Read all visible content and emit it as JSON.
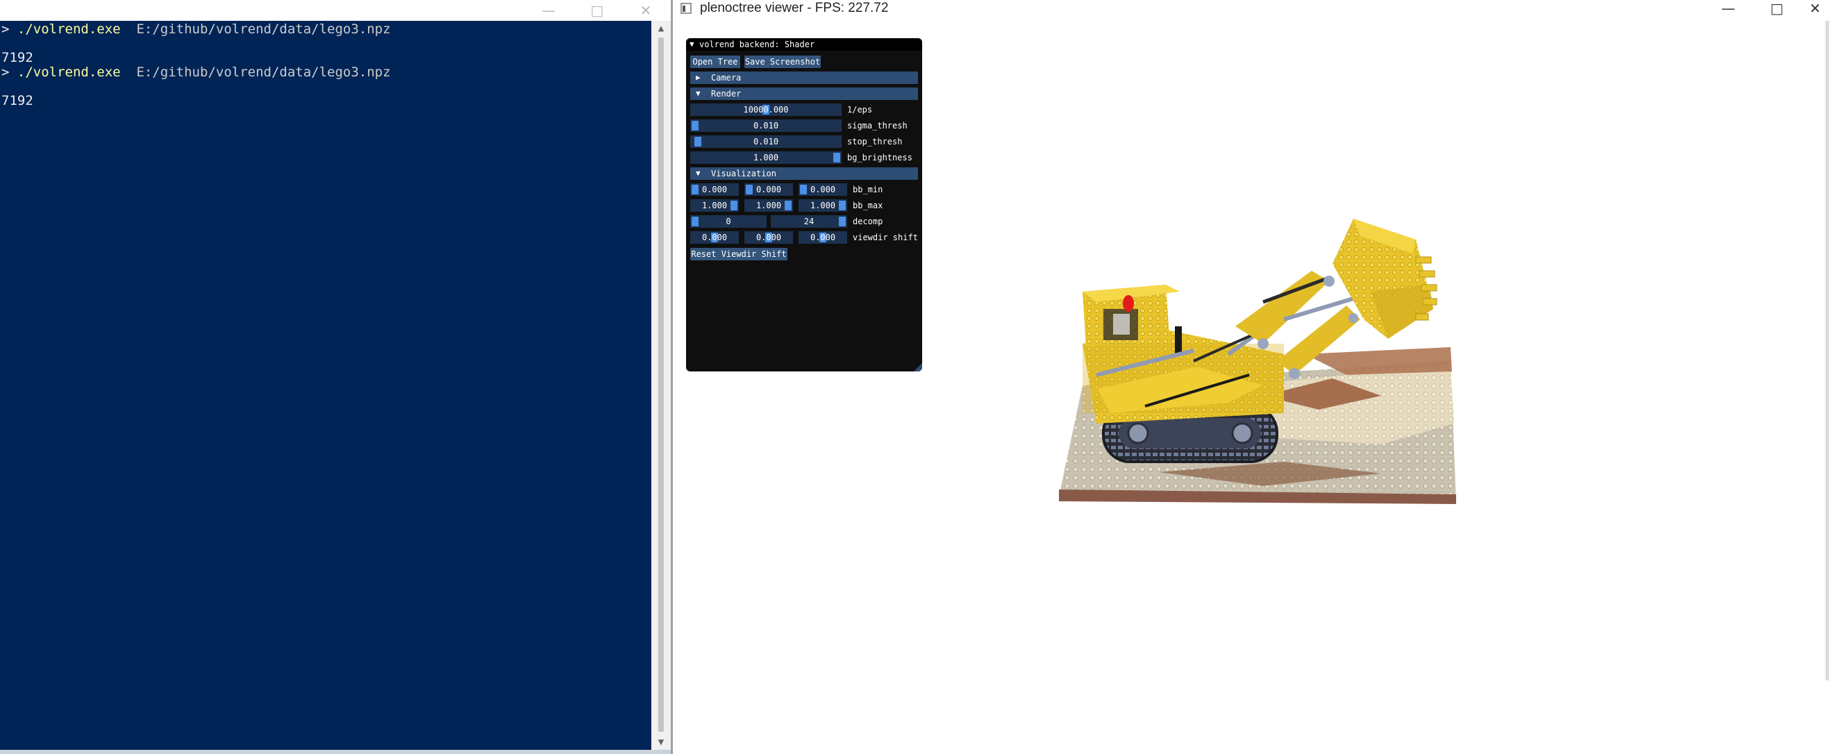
{
  "terminal": {
    "lines": [
      {
        "prefix": "> ",
        "cmd": "./volrend.exe",
        "arg": "  E:/github/volrend/data/lego3.npz"
      },
      {
        "prefix": "",
        "cmd": "",
        "arg": "",
        "text": "7192"
      },
      {
        "prefix": "> ",
        "cmd": "./volrend.exe",
        "arg": "  E:/github/volrend/data/lego3.npz"
      },
      {
        "prefix": "",
        "cmd": "",
        "arg": "",
        "text": "7192"
      }
    ],
    "colors": {
      "background": "#012456",
      "command": "#fdfd9e",
      "text": "#eeedf0"
    },
    "icons": {
      "minimize": "minimize-icon",
      "maximize": "maximize-icon",
      "close": "close-icon"
    }
  },
  "viewer": {
    "title": "plenoctree viewer - FPS: 227.72",
    "icons": {
      "app": "app-window-icon",
      "minimize": "minimize-icon",
      "maximize": "maximize-icon",
      "close": "close-icon"
    }
  },
  "panel": {
    "title": "volrend backend: Shader",
    "buttons": {
      "open_tree": "Open Tree",
      "save_screenshot": "Save Screenshot",
      "reset_viewdir": "Reset Viewdir Shift"
    },
    "headers": {
      "camera": "Camera",
      "render": "Render",
      "visualization": "Visualization"
    },
    "render": [
      {
        "label": "1/eps",
        "value": "10000.000",
        "level": 0.5
      },
      {
        "label": "sigma_thresh",
        "value": "0.010",
        "level": 0.0
      },
      {
        "label": "stop_thresh",
        "value": "0.010",
        "level": 0.02
      },
      {
        "label": "bg_brightness",
        "value": "1.000",
        "level": 1.0
      }
    ],
    "visualization": {
      "bb_min": {
        "label": "bb_min",
        "values": [
          "0.000",
          "0.000",
          "0.000"
        ],
        "levels": [
          0,
          0,
          0
        ]
      },
      "bb_max": {
        "label": "bb_max",
        "values": [
          "1.000",
          "1.000",
          "1.000"
        ],
        "levels": [
          1,
          1,
          1
        ]
      },
      "decomp": {
        "label": "decomp",
        "values": [
          "0",
          "24"
        ],
        "levels": [
          0,
          1
        ]
      },
      "viewdir_shift": {
        "label": "viewdir shift",
        "values": [
          "0.000",
          "0.000",
          "0.000"
        ],
        "levels": [
          0.5,
          0.5,
          0.5
        ]
      }
    },
    "colors": {
      "accent": "#4a90e6",
      "frame": "#1d3250",
      "header": "#2d4d74",
      "button": "#33557c"
    }
  },
  "scene": {
    "subject": "lego-bulldozer-render"
  }
}
